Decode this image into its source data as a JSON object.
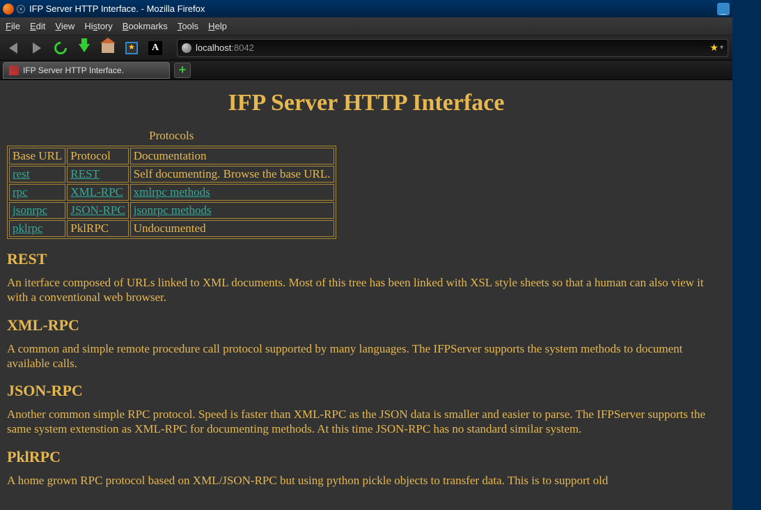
{
  "window": {
    "title": "IFP Server HTTP Interface. - Mozilla Firefox"
  },
  "menu": {
    "file": "File",
    "edit": "Edit",
    "view": "View",
    "history": "History",
    "bookmarks": "Bookmarks",
    "tools": "Tools",
    "help": "Help"
  },
  "url": {
    "host": "localhost",
    "port": ":8042"
  },
  "tab": {
    "label": "IFP Server HTTP Interface."
  },
  "page": {
    "h1": "IFP Server HTTP Interface",
    "table_caption": "Protocols",
    "headers": {
      "base_url": "Base URL",
      "protocol": "Protocol",
      "doc": "Documentation"
    },
    "rows": [
      {
        "base": "rest",
        "proto": "REST",
        "doc": "Self documenting. Browse the base URL.",
        "base_link": true,
        "proto_link": true,
        "doc_link": false
      },
      {
        "base": "rpc",
        "proto": "XML-RPC",
        "doc": "xmlrpc methods",
        "base_link": true,
        "proto_link": true,
        "doc_link": true
      },
      {
        "base": "jsonrpc",
        "proto": "JSON-RPC",
        "doc": "jsonrpc methods",
        "base_link": true,
        "proto_link": true,
        "doc_link": true
      },
      {
        "base": "pklrpc",
        "proto": "PklRPC",
        "doc": "Undocumented",
        "base_link": true,
        "proto_link": false,
        "doc_link": false
      }
    ],
    "sections": [
      {
        "h": "REST",
        "p": "An iterface composed of URLs linked to XML documents. Most of this tree has been linked with XSL style sheets so that a human can also view it with a conventional web browser."
      },
      {
        "h": "XML-RPC",
        "p": "A common and simple remote procedure call protocol supported by many languages. The IFPServer supports the system methods to document available calls."
      },
      {
        "h": "JSON-RPC",
        "p": "Another common simple RPC protocol. Speed is faster than XML-RPC as the JSON data is smaller and easier to parse. The IFPServer supports the same system extenstion as XML-RPC for documenting methods. At this time JSON-RPC has no standard similar system."
      },
      {
        "h": "PklRPC",
        "p": "A home grown RPC protocol based on XML/JSON-RPC but using python pickle objects to transfer data. This is to support old"
      }
    ]
  }
}
